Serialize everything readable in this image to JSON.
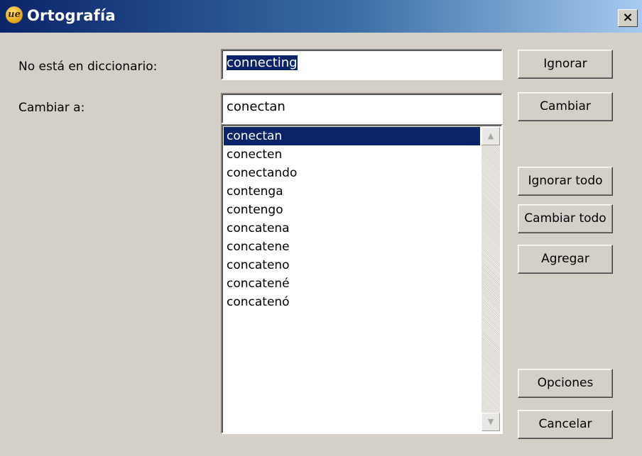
{
  "window": {
    "title": "Ortografía",
    "icon": "ultraedit-app-icon",
    "icon_glyph": "ue",
    "close_glyph": "×"
  },
  "labels": {
    "not_in_dictionary": "No está en diccionario:",
    "change_to": "Cambiar a:"
  },
  "fields": {
    "not_in_dictionary_value": "connecting",
    "change_to_value": "conectan"
  },
  "suggestions": [
    "conectan",
    "conecten",
    "conectando",
    "contenga",
    "contengo",
    "concatena",
    "concatene",
    "concateno",
    "concatené",
    "concatenó"
  ],
  "selected_suggestion": "conectan",
  "scroll_glyphs": {
    "up": "▲",
    "down": "▼"
  },
  "buttons": {
    "ignore": "Ignorar",
    "change": "Cambiar",
    "ignore_all": "Ignorar todo",
    "change_all": "Cambiar todo",
    "add": "Agregar",
    "options": "Opciones",
    "cancel": "Cancelar"
  },
  "colors": {
    "selection": "#0a246a",
    "dialog_face": "#d4d0c8",
    "title_gradient_start": "#0a246a",
    "title_gradient_end": "#a6caf0"
  }
}
